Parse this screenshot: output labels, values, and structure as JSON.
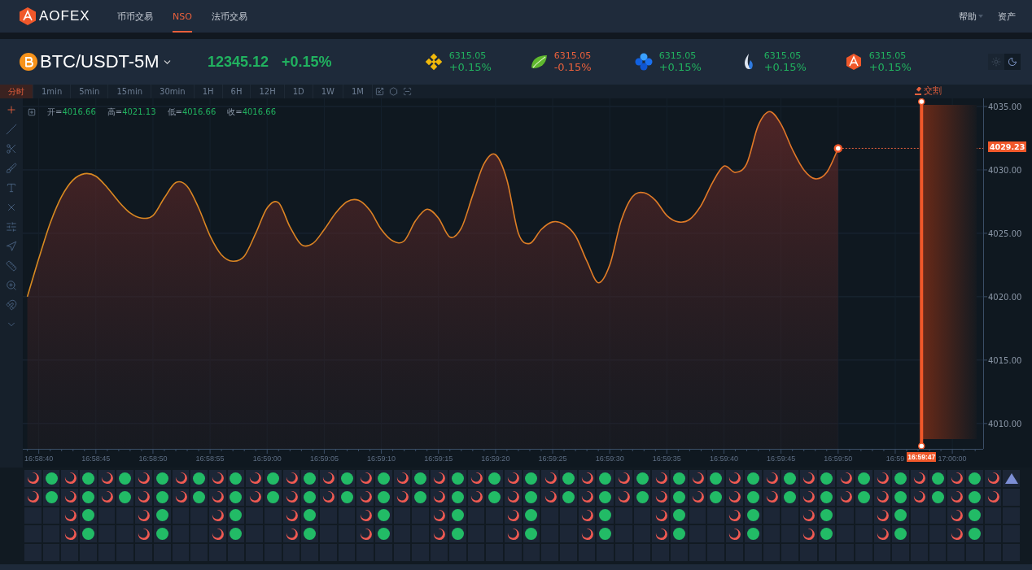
{
  "header": {
    "logo": "AOFEX",
    "nav": [
      {
        "label": "币币交易",
        "selected": false
      },
      {
        "label": "NSO",
        "selected": true
      },
      {
        "label": "法币交易",
        "selected": false
      }
    ],
    "right": [
      {
        "label": "帮助",
        "kind": "dropdown"
      },
      {
        "label": "资产",
        "kind": "link"
      }
    ]
  },
  "ticker": {
    "symbol": "BTC/USDT-5M",
    "price": "12345.12",
    "change": "+0.15%",
    "coins": [
      {
        "price": "6315.05",
        "change": "+0.15%",
        "negative": false
      },
      {
        "price": "6315.05",
        "change": "-0.15%",
        "negative": true
      },
      {
        "price": "6315.05",
        "change": "+0.15%",
        "negative": false
      },
      {
        "price": "6315.05",
        "change": "+0.15%",
        "negative": false
      },
      {
        "price": "6315.05",
        "change": "+0.15%",
        "negative": false
      }
    ],
    "theme": [
      {
        "kind": "light",
        "selected": false
      },
      {
        "kind": "dark",
        "selected": true
      }
    ]
  },
  "intervals": [
    {
      "label": "分时",
      "selected": true
    },
    {
      "label": "1min",
      "selected": false
    },
    {
      "label": "5min",
      "selected": false
    },
    {
      "label": "15min",
      "selected": false
    },
    {
      "label": "30min",
      "selected": false
    },
    {
      "label": "1H",
      "selected": false
    },
    {
      "label": "6H",
      "selected": false
    },
    {
      "label": "12H",
      "selected": false
    },
    {
      "label": "1D",
      "selected": false
    },
    {
      "label": "1W",
      "selected": false
    },
    {
      "label": "1M",
      "selected": false
    }
  ],
  "tools": [
    {
      "selected": true
    },
    {
      "selected": false
    },
    {
      "selected": false
    },
    {
      "selected": false
    },
    {
      "selected": false
    },
    {
      "selected": false
    },
    {
      "selected": false
    },
    {
      "selected": false
    },
    {
      "selected": false
    },
    {
      "selected": false
    },
    {
      "selected": false
    },
    {
      "selected": false
    }
  ],
  "legend": [
    {
      "label": "开=",
      "value": "4016.66"
    },
    {
      "label": "高=",
      "value": "4021.13"
    },
    {
      "label": "低=",
      "value": "4016.66"
    },
    {
      "label": "收=",
      "value": "4016.66"
    }
  ],
  "chart_data": {
    "type": "area",
    "grid": true,
    "categories": [
      null,
      "16:58:40",
      null,
      null,
      null,
      null,
      "16:58:45",
      null,
      null,
      null,
      null,
      "16:58:50",
      null,
      null,
      null,
      null,
      "16:58:55",
      null,
      null,
      null,
      null,
      "16:59:00",
      null,
      null,
      null,
      null,
      "16:59:05",
      null,
      null,
      null,
      null,
      "16:59:10",
      null,
      null,
      null,
      null,
      "16:59:15",
      null,
      null,
      null,
      null,
      "16:59:20",
      null,
      null,
      null,
      null,
      "16:59:25",
      null,
      null,
      null,
      null,
      "16:59:30",
      null,
      null,
      null,
      null,
      "16:59:35",
      null,
      null,
      null,
      null,
      "16:59:40",
      null,
      null,
      null,
      null,
      "16:59:45",
      null,
      null,
      null,
      null,
      "16:59:50",
      null,
      null,
      null,
      null,
      "16:59",
      null,
      null,
      null,
      null,
      "17:00:00",
      null,
      null
    ],
    "series": [
      {
        "color": "#e27628",
        "values": [
          4020.0,
          4023.0,
          4025.8,
          4027.9,
          4029.2,
          4029.7,
          4029.5,
          4028.6,
          4027.5,
          4026.6,
          4026.2,
          4026.4,
          4027.8,
          4029.0,
          4028.7,
          4027.0,
          4024.8,
          4023.3,
          4022.8,
          4023.2,
          4025.0,
          4027.0,
          4027.4,
          4025.5,
          4024.1,
          4024.2,
          4025.3,
          4026.6,
          4027.5,
          4027.6,
          4026.8,
          4025.3,
          4024.4,
          4024.4,
          4026.0,
          4026.9,
          4026.2,
          4024.7,
          4025.4,
          4028.0,
          4030.5,
          4031.2,
          4029.2,
          4025.0,
          4024.2,
          4025.3,
          4025.9,
          4025.7,
          4024.8,
          4022.8,
          4021.1,
          4022.5,
          4026.0,
          4027.9,
          4028.2,
          4027.6,
          4026.4,
          4025.9,
          4026.1,
          4027.2,
          4029.0,
          4030.3,
          4029.8,
          4030.5,
          4033.5,
          4034.6,
          4033.6,
          4031.6,
          4030.0,
          4029.3,
          4029.8,
          4031.7,
          null,
          null,
          null,
          null,
          null,
          null,
          null,
          null,
          null,
          null,
          null,
          null
        ]
      }
    ],
    "ylim": [
      4008,
      4035.64
    ],
    "yticks": [
      {
        "value": 4010,
        "label": "4010.00"
      },
      {
        "value": 4015,
        "label": "4015.00"
      },
      {
        "value": 4020,
        "label": "4020.00"
      },
      {
        "value": 4025,
        "label": "4025.00"
      },
      {
        "value": 4030,
        "label": "4030.00"
      },
      {
        "value": 4035,
        "label": "4035.00"
      }
    ]
  },
  "price_marker": {
    "label": "4029.23"
  },
  "settlement": {
    "label": "交割",
    "time": "16:59:47"
  },
  "board": [
    {
      "cells": [
        {
          "kind": "crescent"
        },
        {
          "kind": "dot"
        },
        {
          "kind": "crescent"
        },
        {
          "kind": "dot"
        },
        {
          "kind": "crescent"
        },
        {
          "kind": "dot"
        },
        {
          "kind": "crescent"
        },
        {
          "kind": "dot"
        },
        {
          "kind": "crescent"
        },
        {
          "kind": "dot"
        },
        {
          "kind": "crescent"
        },
        {
          "kind": "dot"
        },
        {
          "kind": "crescent"
        },
        {
          "kind": "dot"
        },
        {
          "kind": "crescent"
        },
        {
          "kind": "dot"
        },
        {
          "kind": "crescent"
        },
        {
          "kind": "dot"
        },
        {
          "kind": "crescent"
        },
        {
          "kind": "dot"
        },
        {
          "kind": "crescent"
        },
        {
          "kind": "dot"
        },
        {
          "kind": "crescent"
        },
        {
          "kind": "dot"
        },
        {
          "kind": "crescent"
        },
        {
          "kind": "dot"
        },
        {
          "kind": "crescent"
        },
        {
          "kind": "dot"
        },
        {
          "kind": "crescent"
        },
        {
          "kind": "dot"
        },
        {
          "kind": "crescent"
        },
        {
          "kind": "dot"
        },
        {
          "kind": "crescent"
        },
        {
          "kind": "dot"
        },
        {
          "kind": "crescent"
        },
        {
          "kind": "dot"
        },
        {
          "kind": "crescent"
        },
        {
          "kind": "dot"
        },
        {
          "kind": "crescent"
        },
        {
          "kind": "dot"
        },
        {
          "kind": "crescent"
        },
        {
          "kind": "dot"
        },
        {
          "kind": "crescent"
        },
        {
          "kind": "dot"
        },
        {
          "kind": "crescent"
        },
        {
          "kind": "dot"
        },
        {
          "kind": "crescent"
        },
        {
          "kind": "dot"
        },
        {
          "kind": "crescent"
        },
        {
          "kind": "dot"
        },
        {
          "kind": "crescent"
        },
        {
          "kind": "dot"
        },
        {
          "kind": "crescent"
        },
        {
          "kind": "triangle"
        }
      ]
    },
    {
      "cells": [
        {
          "kind": "crescent"
        },
        {
          "kind": "dot"
        },
        {
          "kind": "crescent"
        },
        {
          "kind": "dot"
        },
        {
          "kind": "crescent"
        },
        {
          "kind": "dot"
        },
        {
          "kind": "crescent"
        },
        {
          "kind": "dot"
        },
        {
          "kind": "crescent"
        },
        {
          "kind": "dot"
        },
        {
          "kind": "crescent"
        },
        {
          "kind": "dot"
        },
        {
          "kind": "crescent"
        },
        {
          "kind": "dot"
        },
        {
          "kind": "crescent"
        },
        {
          "kind": "dot"
        },
        {
          "kind": "crescent"
        },
        {
          "kind": "dot"
        },
        {
          "kind": "crescent"
        },
        {
          "kind": "dot"
        },
        {
          "kind": "crescent"
        },
        {
          "kind": "dot"
        },
        {
          "kind": "crescent"
        },
        {
          "kind": "dot"
        },
        {
          "kind": "crescent"
        },
        {
          "kind": "dot"
        },
        {
          "kind": "crescent"
        },
        {
          "kind": "dot"
        },
        {
          "kind": "crescent"
        },
        {
          "kind": "dot"
        },
        {
          "kind": "crescent"
        },
        {
          "kind": "dot"
        },
        {
          "kind": "crescent"
        },
        {
          "kind": "dot"
        },
        {
          "kind": "crescent"
        },
        {
          "kind": "dot"
        },
        {
          "kind": "crescent"
        },
        {
          "kind": "dot"
        },
        {
          "kind": "crescent"
        },
        {
          "kind": "dot"
        },
        {
          "kind": "crescent"
        },
        {
          "kind": "dot"
        },
        {
          "kind": "crescent"
        },
        {
          "kind": "dot"
        },
        {
          "kind": "crescent"
        },
        {
          "kind": "dot"
        },
        {
          "kind": "crescent"
        },
        {
          "kind": "dot"
        },
        {
          "kind": "crescent"
        },
        {
          "kind": "dot"
        },
        {
          "kind": "crescent"
        },
        {
          "kind": "dot"
        },
        {
          "kind": "crescent"
        },
        {
          "kind": "empty"
        }
      ]
    },
    {
      "cells": [
        {
          "kind": "empty"
        },
        {
          "kind": "empty"
        },
        {
          "kind": "crescent"
        },
        {
          "kind": "dot"
        },
        {
          "kind": "empty"
        },
        {
          "kind": "empty"
        },
        {
          "kind": "crescent"
        },
        {
          "kind": "dot"
        },
        {
          "kind": "empty"
        },
        {
          "kind": "empty"
        },
        {
          "kind": "crescent"
        },
        {
          "kind": "dot"
        },
        {
          "kind": "empty"
        },
        {
          "kind": "empty"
        },
        {
          "kind": "crescent"
        },
        {
          "kind": "dot"
        },
        {
          "kind": "empty"
        },
        {
          "kind": "empty"
        },
        {
          "kind": "crescent"
        },
        {
          "kind": "dot"
        },
        {
          "kind": "empty"
        },
        {
          "kind": "empty"
        },
        {
          "kind": "crescent"
        },
        {
          "kind": "dot"
        },
        {
          "kind": "empty"
        },
        {
          "kind": "empty"
        },
        {
          "kind": "crescent"
        },
        {
          "kind": "dot"
        },
        {
          "kind": "empty"
        },
        {
          "kind": "empty"
        },
        {
          "kind": "crescent"
        },
        {
          "kind": "dot"
        },
        {
          "kind": "empty"
        },
        {
          "kind": "empty"
        },
        {
          "kind": "crescent"
        },
        {
          "kind": "dot"
        },
        {
          "kind": "empty"
        },
        {
          "kind": "empty"
        },
        {
          "kind": "crescent"
        },
        {
          "kind": "dot"
        },
        {
          "kind": "empty"
        },
        {
          "kind": "empty"
        },
        {
          "kind": "crescent"
        },
        {
          "kind": "dot"
        },
        {
          "kind": "empty"
        },
        {
          "kind": "empty"
        },
        {
          "kind": "crescent"
        },
        {
          "kind": "dot"
        },
        {
          "kind": "empty"
        },
        {
          "kind": "empty"
        },
        {
          "kind": "crescent"
        },
        {
          "kind": "dot"
        },
        {
          "kind": "empty"
        },
        {
          "kind": "empty"
        }
      ]
    },
    {
      "cells": [
        {
          "kind": "empty"
        },
        {
          "kind": "empty"
        },
        {
          "kind": "crescent"
        },
        {
          "kind": "dot"
        },
        {
          "kind": "empty"
        },
        {
          "kind": "empty"
        },
        {
          "kind": "crescent"
        },
        {
          "kind": "dot"
        },
        {
          "kind": "empty"
        },
        {
          "kind": "empty"
        },
        {
          "kind": "crescent"
        },
        {
          "kind": "dot"
        },
        {
          "kind": "empty"
        },
        {
          "kind": "empty"
        },
        {
          "kind": "crescent"
        },
        {
          "kind": "dot"
        },
        {
          "kind": "empty"
        },
        {
          "kind": "empty"
        },
        {
          "kind": "crescent"
        },
        {
          "kind": "dot"
        },
        {
          "kind": "empty"
        },
        {
          "kind": "empty"
        },
        {
          "kind": "crescent"
        },
        {
          "kind": "dot"
        },
        {
          "kind": "empty"
        },
        {
          "kind": "empty"
        },
        {
          "kind": "crescent"
        },
        {
          "kind": "dot"
        },
        {
          "kind": "empty"
        },
        {
          "kind": "empty"
        },
        {
          "kind": "crescent"
        },
        {
          "kind": "dot"
        },
        {
          "kind": "empty"
        },
        {
          "kind": "empty"
        },
        {
          "kind": "crescent"
        },
        {
          "kind": "dot"
        },
        {
          "kind": "empty"
        },
        {
          "kind": "empty"
        },
        {
          "kind": "crescent"
        },
        {
          "kind": "dot"
        },
        {
          "kind": "empty"
        },
        {
          "kind": "empty"
        },
        {
          "kind": "crescent"
        },
        {
          "kind": "dot"
        },
        {
          "kind": "empty"
        },
        {
          "kind": "empty"
        },
        {
          "kind": "crescent"
        },
        {
          "kind": "dot"
        },
        {
          "kind": "empty"
        },
        {
          "kind": "empty"
        },
        {
          "kind": "crescent"
        },
        {
          "kind": "dot"
        },
        {
          "kind": "empty"
        },
        {
          "kind": "empty"
        }
      ]
    },
    {
      "cells": [
        {
          "kind": "empty"
        },
        {
          "kind": "empty"
        },
        {
          "kind": "empty"
        },
        {
          "kind": "empty"
        },
        {
          "kind": "empty"
        },
        {
          "kind": "empty"
        },
        {
          "kind": "empty"
        },
        {
          "kind": "empty"
        },
        {
          "kind": "empty"
        },
        {
          "kind": "empty"
        },
        {
          "kind": "empty"
        },
        {
          "kind": "empty"
        },
        {
          "kind": "empty"
        },
        {
          "kind": "empty"
        },
        {
          "kind": "empty"
        },
        {
          "kind": "empty"
        },
        {
          "kind": "empty"
        },
        {
          "kind": "empty"
        },
        {
          "kind": "empty"
        },
        {
          "kind": "empty"
        },
        {
          "kind": "empty"
        },
        {
          "kind": "empty"
        },
        {
          "kind": "empty"
        },
        {
          "kind": "empty"
        },
        {
          "kind": "empty"
        },
        {
          "kind": "empty"
        },
        {
          "kind": "empty"
        },
        {
          "kind": "empty"
        },
        {
          "kind": "empty"
        },
        {
          "kind": "empty"
        },
        {
          "kind": "empty"
        },
        {
          "kind": "empty"
        },
        {
          "kind": "empty"
        },
        {
          "kind": "empty"
        },
        {
          "kind": "empty"
        },
        {
          "kind": "empty"
        },
        {
          "kind": "empty"
        },
        {
          "kind": "empty"
        },
        {
          "kind": "empty"
        },
        {
          "kind": "empty"
        },
        {
          "kind": "empty"
        },
        {
          "kind": "empty"
        },
        {
          "kind": "empty"
        },
        {
          "kind": "empty"
        },
        {
          "kind": "empty"
        },
        {
          "kind": "empty"
        },
        {
          "kind": "empty"
        },
        {
          "kind": "empty"
        },
        {
          "kind": "empty"
        },
        {
          "kind": "empty"
        },
        {
          "kind": "empty"
        },
        {
          "kind": "empty"
        },
        {
          "kind": "empty"
        },
        {
          "kind": "empty"
        }
      ]
    }
  ]
}
